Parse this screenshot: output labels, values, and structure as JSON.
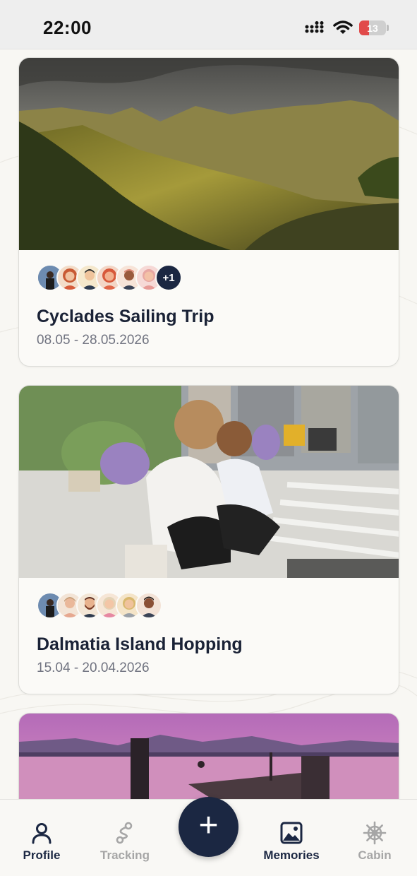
{
  "status_bar": {
    "time": "22:00",
    "battery": "13",
    "icons": [
      "cellular-signal-icon",
      "wifi-icon",
      "battery-icon"
    ]
  },
  "trips": [
    {
      "title": "Cyclades Sailing Trip",
      "dates": "08.05 - 28.05.2026",
      "image": "mountain-valley-photo",
      "extra_members": "+1"
    },
    {
      "title": "Dalmatia Island Hopping",
      "dates": "15.04 - 20.04.2026",
      "image": "city-street-mother-child-photo"
    },
    {
      "image": "pier-sunset-photo"
    }
  ],
  "bottom_nav": {
    "items": [
      {
        "label": "Profile",
        "icon": "person-icon"
      },
      {
        "label": "Tracking",
        "icon": "route-icon"
      },
      {
        "label": "Memories",
        "icon": "image-icon"
      },
      {
        "label": "Cabin",
        "icon": "ship-wheel-icon"
      }
    ],
    "fab_label": "+"
  },
  "colors": {
    "primary": "#1b2742",
    "muted": "#a6a6a6",
    "background": "#f8f7f3",
    "battery_low": "#e14a4a"
  }
}
